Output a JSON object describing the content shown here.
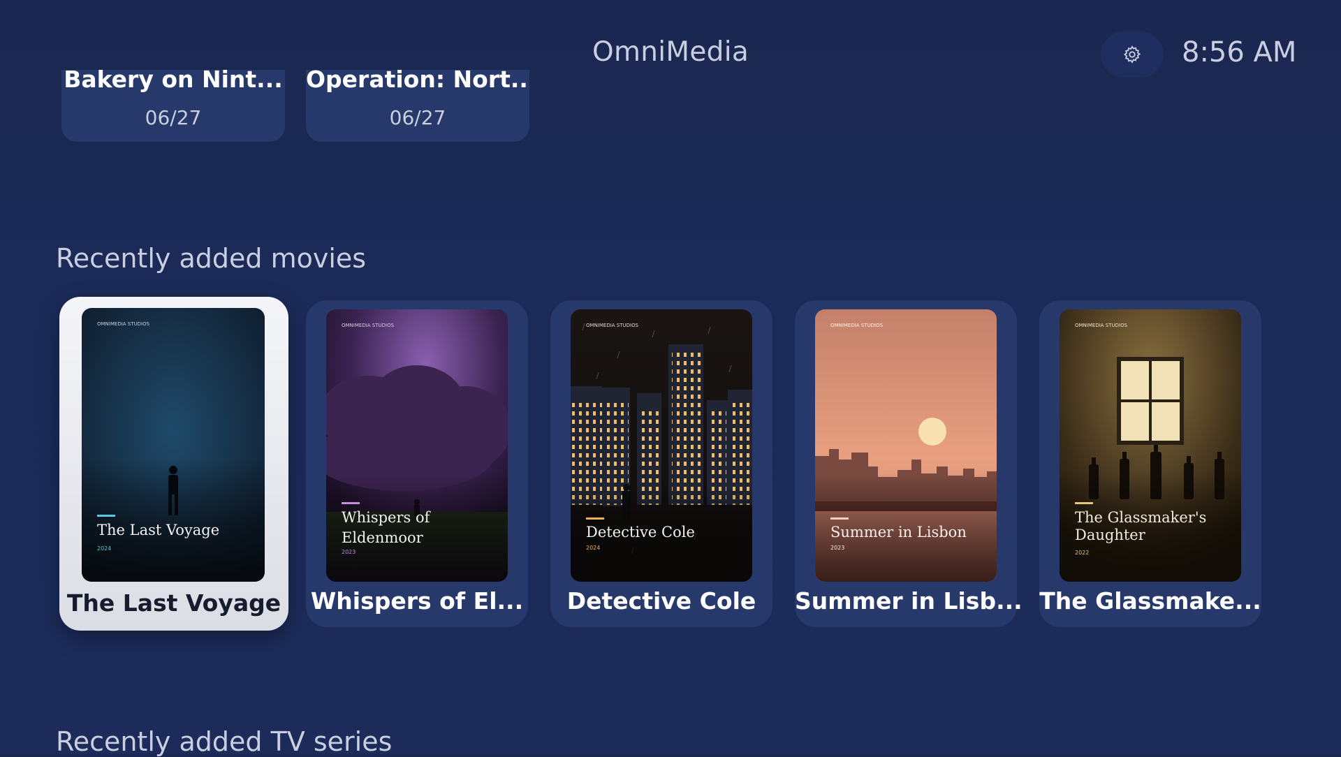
{
  "header": {
    "app_title": "OmniMedia",
    "time": "8:56 AM",
    "settings_icon": "gear-icon"
  },
  "top_row": [
    {
      "title": "Bakery on Nint...",
      "date": "06/27"
    },
    {
      "title": "Operation: Nort...",
      "date": "06/27"
    }
  ],
  "sections": {
    "movies_title": "Recently added movies",
    "tv_title": "Recently added TV series"
  },
  "movies": [
    {
      "card_title": "The Last Voyage",
      "poster_title_line1": "The Last Voyage",
      "poster_title_line2": "",
      "year": "2024",
      "studio": "OMNIMEDIA STUDIOS",
      "accent": "#5cc8e8"
    },
    {
      "card_title": "Whispers of El...",
      "poster_title_line1": "Whispers of",
      "poster_title_line2": "Eldenmoor",
      "year": "2023",
      "studio": "OMNIMEDIA STUDIOS",
      "accent": "#c48de0"
    },
    {
      "card_title": "Detective Cole",
      "poster_title_line1": "Detective Cole",
      "poster_title_line2": "",
      "year": "2024",
      "studio": "OMNIMEDIA STUDIOS",
      "accent": "#f0b050"
    },
    {
      "card_title": "Summer in Lisb...",
      "poster_title_line1": "Summer in Lisbon",
      "poster_title_line2": "",
      "year": "2023",
      "studio": "OMNIMEDIA STUDIOS",
      "accent": "#f3d3c0"
    },
    {
      "card_title": "The Glassmake...",
      "poster_title_line1": "The Glassmaker's",
      "poster_title_line2": "Daughter",
      "year": "2022",
      "studio": "OMNIMEDIA STUDIOS",
      "accent": "#e6c77a"
    }
  ]
}
